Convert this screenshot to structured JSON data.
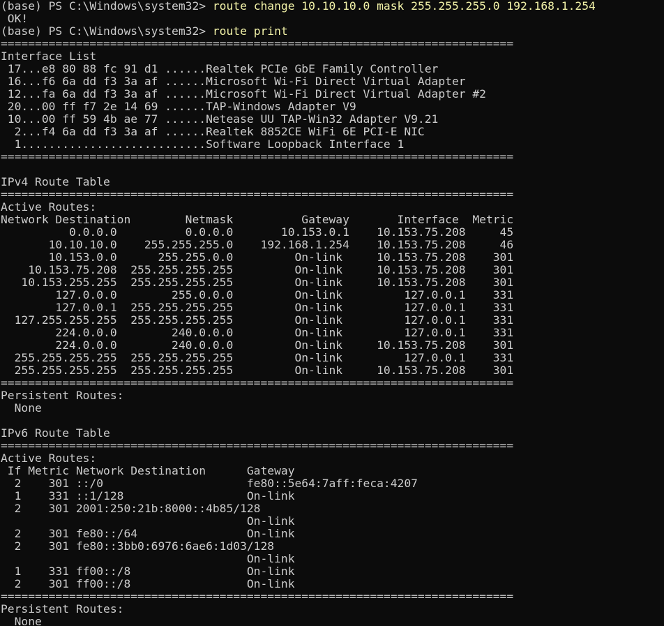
{
  "prompt": "(base) PS C:\\Windows\\system32> ",
  "command_1": "route change 10.10.10.0 mask 255.255.255.0 192.168.1.254",
  "ok": " OK!",
  "command_2": "route print",
  "separator": "===========================================================================",
  "interface_list": {
    "title": "Interface List",
    "items": [
      " 17...e8 80 88 fc 91 d1 ......Realtek PCIe GbE Family Controller",
      " 16...f6 6a dd f3 3a af ......Microsoft Wi-Fi Direct Virtual Adapter",
      " 12...fa 6a dd f3 3a af ......Microsoft Wi-Fi Direct Virtual Adapter #2",
      " 20...00 ff f7 2e 14 69 ......TAP-Windows Adapter V9",
      " 10...00 ff 59 4b ae 77 ......Netease UU TAP-Win32 Adapter V9.21",
      "  2...f4 6a dd f3 3a af ......Realtek 8852CE WiFi 6E PCI-E NIC",
      "  1...........................Software Loopback Interface 1"
    ]
  },
  "ipv4": {
    "title": "IPv4 Route Table",
    "active_label": "Active Routes:",
    "header": "Network Destination        Netmask          Gateway       Interface  Metric",
    "rows": [
      "          0.0.0.0          0.0.0.0       10.153.0.1    10.153.75.208     45",
      "       10.10.10.0    255.255.255.0    192.168.1.254    10.153.75.208     46",
      "       10.153.0.0      255.255.0.0         On-link     10.153.75.208    301",
      "    10.153.75.208  255.255.255.255         On-link     10.153.75.208    301",
      "   10.153.255.255  255.255.255.255         On-link     10.153.75.208    301",
      "        127.0.0.0        255.0.0.0         On-link         127.0.0.1    331",
      "        127.0.0.1  255.255.255.255         On-link         127.0.0.1    331",
      "  127.255.255.255  255.255.255.255         On-link         127.0.0.1    331",
      "        224.0.0.0        240.0.0.0         On-link         127.0.0.1    331",
      "        224.0.0.0        240.0.0.0         On-link     10.153.75.208    301",
      "  255.255.255.255  255.255.255.255         On-link         127.0.0.1    331",
      "  255.255.255.255  255.255.255.255         On-link     10.153.75.208    301"
    ],
    "persistent_label": "Persistent Routes:",
    "persistent_value": "  None"
  },
  "ipv6": {
    "title": "IPv6 Route Table",
    "active_label": "Active Routes:",
    "header": " If Metric Network Destination      Gateway",
    "rows": [
      "  2    301 ::/0                     fe80::5e64:7aff:feca:4207",
      "  1    331 ::1/128                  On-link",
      "  2    301 2001:250:21b:8000::4b85/128",
      "                                    On-link",
      "  2    301 fe80::/64                On-link",
      "  2    301 fe80::3bb0:6976:6ae6:1d03/128",
      "                                    On-link",
      "  1    331 ff00::/8                 On-link",
      "  2    301 ff00::/8                 On-link"
    ],
    "persistent_label": "Persistent Routes:",
    "persistent_value": "  None"
  }
}
